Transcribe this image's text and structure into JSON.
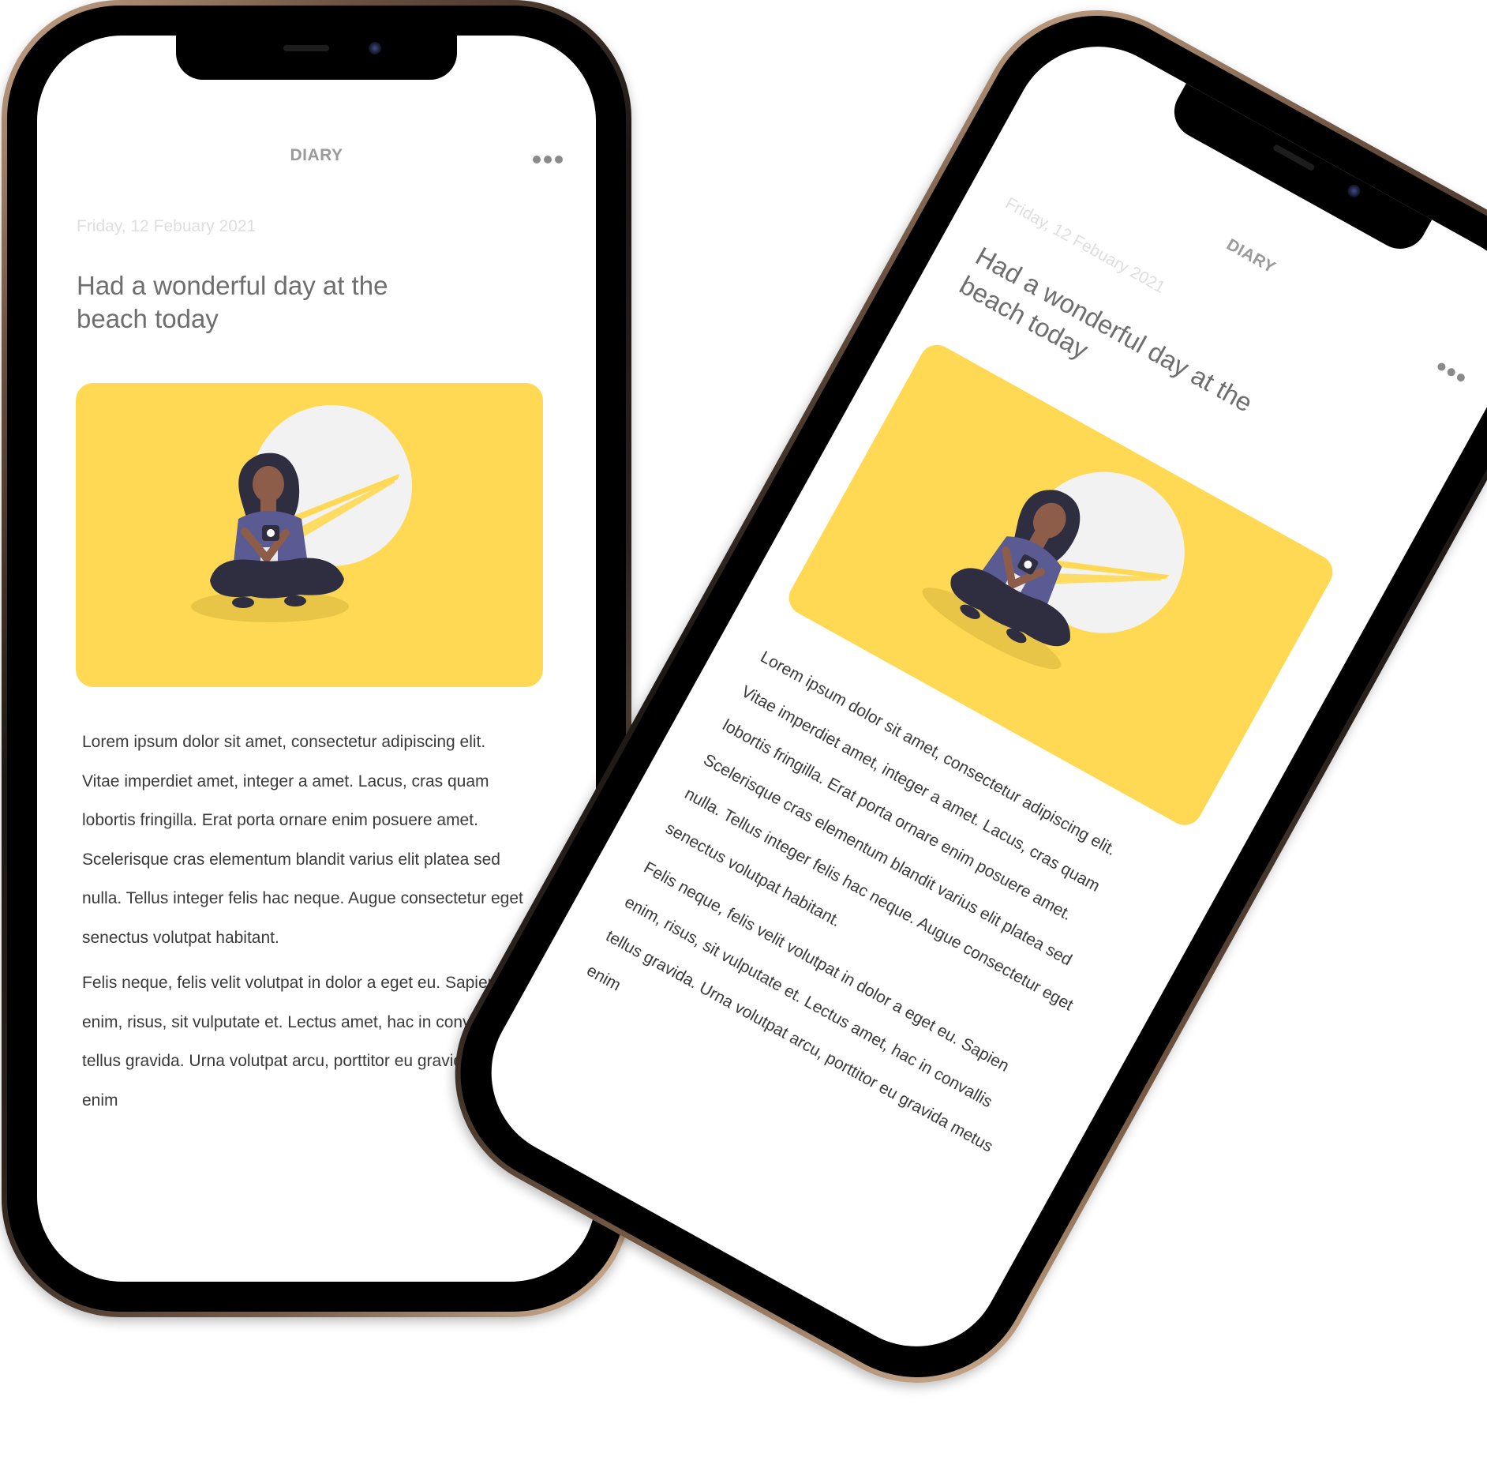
{
  "app": {
    "title": "DIARY",
    "more_icon": "more-dots-icon"
  },
  "entry": {
    "date": "Friday, 12 Febuary 2021",
    "title": "Had a wonderful day at the beach today",
    "illustration": "woman-with-camera-illustration",
    "paragraphs": [
      "Lorem ipsum dolor sit amet, consectetur adipiscing elit. Vitae imperdiet amet, integer a amet. Lacus, cras quam lobortis fringilla. Erat porta ornare enim posuere amet. Scelerisque cras elementum blandit varius elit platea sed nulla. Tellus integer felis hac neque. Augue consectetur eget senectus volutpat habitant.",
      "Felis neque, felis velit volutpat in dolor a eget eu. Sapien enim, risus, sit vulputate et. Lectus amet, hac in convallis tellus gravida. Urna volutpat arcu, porttitor eu gravida metus enim"
    ]
  },
  "colors": {
    "card_background": "#ffd954",
    "title_text": "#6e6e6e",
    "date_text": "#dedede",
    "body_text": "#3a3a3a",
    "phone_frame": "#1c1714",
    "phone_trim": "#caa88a"
  }
}
